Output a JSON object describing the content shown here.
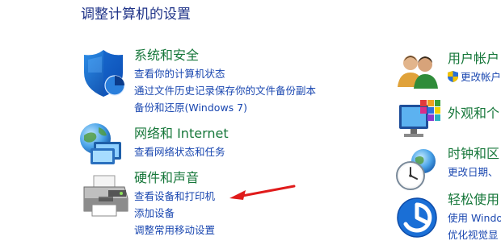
{
  "page": {
    "title": "调整计算机的设置"
  },
  "left": {
    "system_security": {
      "title": "系统和安全",
      "links": [
        "查看你的计算机状态",
        "通过文件历史记录保存你的文件备份副本",
        "备份和还原(Windows 7)"
      ]
    },
    "network": {
      "title": "网络和 Internet",
      "links": [
        "查看网络状态和任务"
      ]
    },
    "hardware": {
      "title": "硬件和声音",
      "links": [
        "查看设备和打印机",
        "添加设备",
        "调整常用移动设置"
      ]
    }
  },
  "right": {
    "user_accounts": {
      "title": "用户帐户",
      "links": [
        "更改帐户"
      ]
    },
    "appearance": {
      "title": "外观和个"
    },
    "clock_region": {
      "title": "时钟和区",
      "links": [
        "更改日期、"
      ]
    },
    "ease_access": {
      "title": "轻松使用",
      "links": [
        "使用 Windo",
        "优化视觉显"
      ]
    }
  },
  "colors": {
    "title_blue": "#1e3287",
    "category_green": "#16773a",
    "link_blue": "#1a47b0",
    "annotation_red": "#e01b1b"
  },
  "icons": {
    "system_security": "shield-icon",
    "network": "network-globe-icon",
    "hardware": "printer-icon",
    "user_accounts": "users-icon",
    "appearance": "monitor-palette-icon",
    "clock_region": "clock-globe-icon",
    "ease_access": "ease-of-access-icon"
  }
}
